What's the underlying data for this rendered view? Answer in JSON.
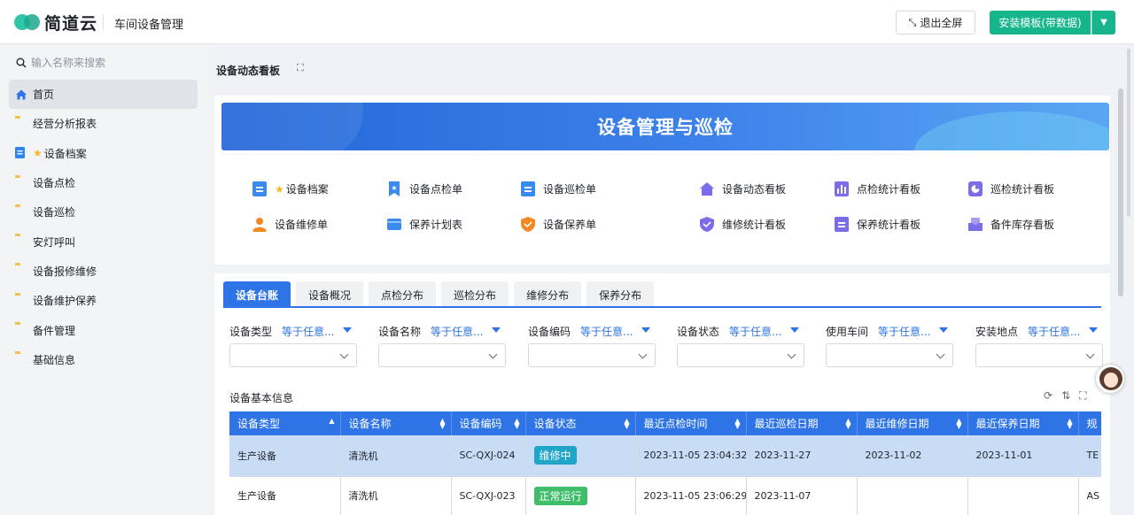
{
  "header": {
    "brand": "简道云",
    "app_name": "车间设备管理",
    "exit_fullscreen": "退出全屏",
    "install_template": "安装模板(带数据)"
  },
  "sidebar": {
    "search_placeholder": "输入名称来搜索",
    "items": [
      {
        "label": "首页",
        "icon": "home-icon"
      },
      {
        "label": "经营分析报表",
        "icon": "folder-icon"
      },
      {
        "label": "设备档案",
        "icon": "form-icon"
      },
      {
        "label": "设备点检",
        "icon": "folder-icon"
      },
      {
        "label": "设备巡检",
        "icon": "folder-icon"
      },
      {
        "label": "安灯呼叫",
        "icon": "folder-icon"
      },
      {
        "label": "设备报修维修",
        "icon": "folder-icon"
      },
      {
        "label": "设备维护保养",
        "icon": "folder-icon"
      },
      {
        "label": "备件管理",
        "icon": "folder-icon"
      },
      {
        "label": "基础信息",
        "icon": "folder-icon"
      }
    ]
  },
  "main": {
    "title": "设备动态看板",
    "banner_title": "设备管理与巡检",
    "shortcuts": [
      {
        "label": "设备档案"
      },
      {
        "label": "设备点检单"
      },
      {
        "label": "设备巡检单"
      },
      {
        "label": "设备动态看板"
      },
      {
        "label": "点检统计看板"
      },
      {
        "label": "巡检统计看板"
      },
      {
        "label": "设备维修单"
      },
      {
        "label": "保养计划表"
      },
      {
        "label": "设备保养单"
      },
      {
        "label": "维修统计看板"
      },
      {
        "label": "保养统计看板"
      },
      {
        "label": "备件库存看板"
      }
    ],
    "tabs": [
      "设备台账",
      "设备概况",
      "点检分布",
      "巡检分布",
      "维修分布",
      "保养分布"
    ],
    "filters": [
      {
        "label": "设备类型",
        "op": "等于任意..."
      },
      {
        "label": "设备名称",
        "op": "等于任意..."
      },
      {
        "label": "设备编码",
        "op": "等于任意..."
      },
      {
        "label": "设备状态",
        "op": "等于任意..."
      },
      {
        "label": "使用车间",
        "op": "等于任意..."
      },
      {
        "label": "安装地点",
        "op": "等于任意..."
      }
    ],
    "table_title": "设备基本信息",
    "columns": [
      "设备类型",
      "设备名称",
      "设备编码",
      "设备状态",
      "最近点检时间",
      "最近巡检日期",
      "最近维修日期",
      "最近保养日期",
      "规"
    ],
    "rows": [
      [
        "生产设备",
        "清洗机",
        "SC-QXJ-024",
        "维修中",
        "2023-11-05 23:04:32",
        "2023-11-27",
        "2023-11-02",
        "2023-11-01",
        "TE"
      ],
      [
        "生产设备",
        "清洗机",
        "SC-QXJ-023",
        "正常运行",
        "2023-11-05 23:06:29",
        "2023-11-07",
        "",
        "",
        "AS"
      ]
    ]
  }
}
